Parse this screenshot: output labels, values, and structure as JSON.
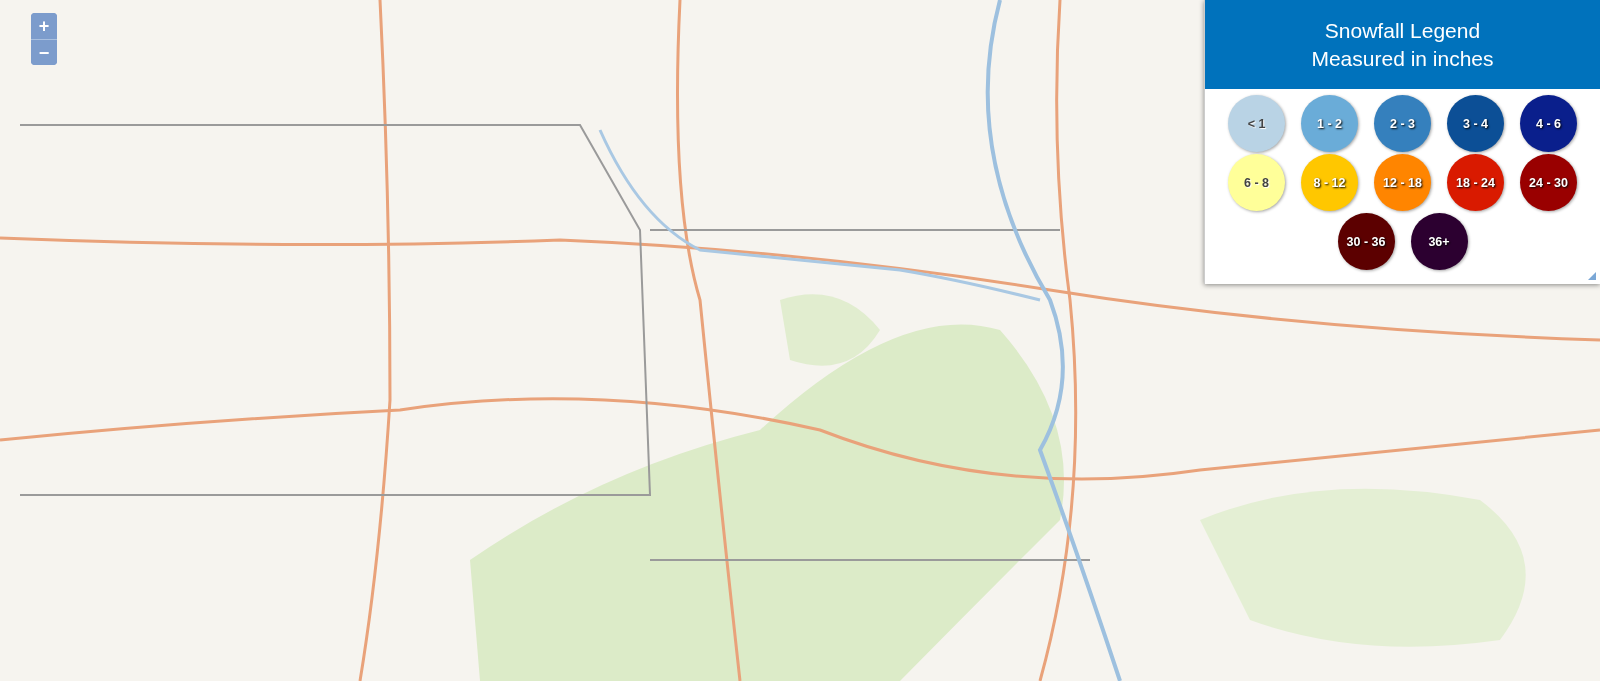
{
  "zoom_controls": [
    "+",
    "−"
  ],
  "legend": {
    "title": "Snowfall Legend",
    "subtitle": "Measured in inches",
    "items": [
      {
        "label": "< 1",
        "color": "#b9d3e5"
      },
      {
        "label": "1 - 2",
        "color": "#6aacd8"
      },
      {
        "label": "2 - 3",
        "color": "#3580bd"
      },
      {
        "label": "3 - 4",
        "color": "#0c4f96"
      },
      {
        "label": "4 - 6",
        "color": "#0a1f8c"
      },
      {
        "label": "6 - 8",
        "color": "#ffff99"
      },
      {
        "label": "8 - 12",
        "color": "#ffc700"
      },
      {
        "label": "12 - 18",
        "color": "#ff8500"
      },
      {
        "label": "18 - 24",
        "color": "#d91a00"
      },
      {
        "label": "24 - 30",
        "color": "#990000"
      },
      {
        "label": "30 - 36",
        "color": "#5c0000"
      },
      {
        "label": "36+",
        "color": "#2c0030"
      }
    ]
  }
}
